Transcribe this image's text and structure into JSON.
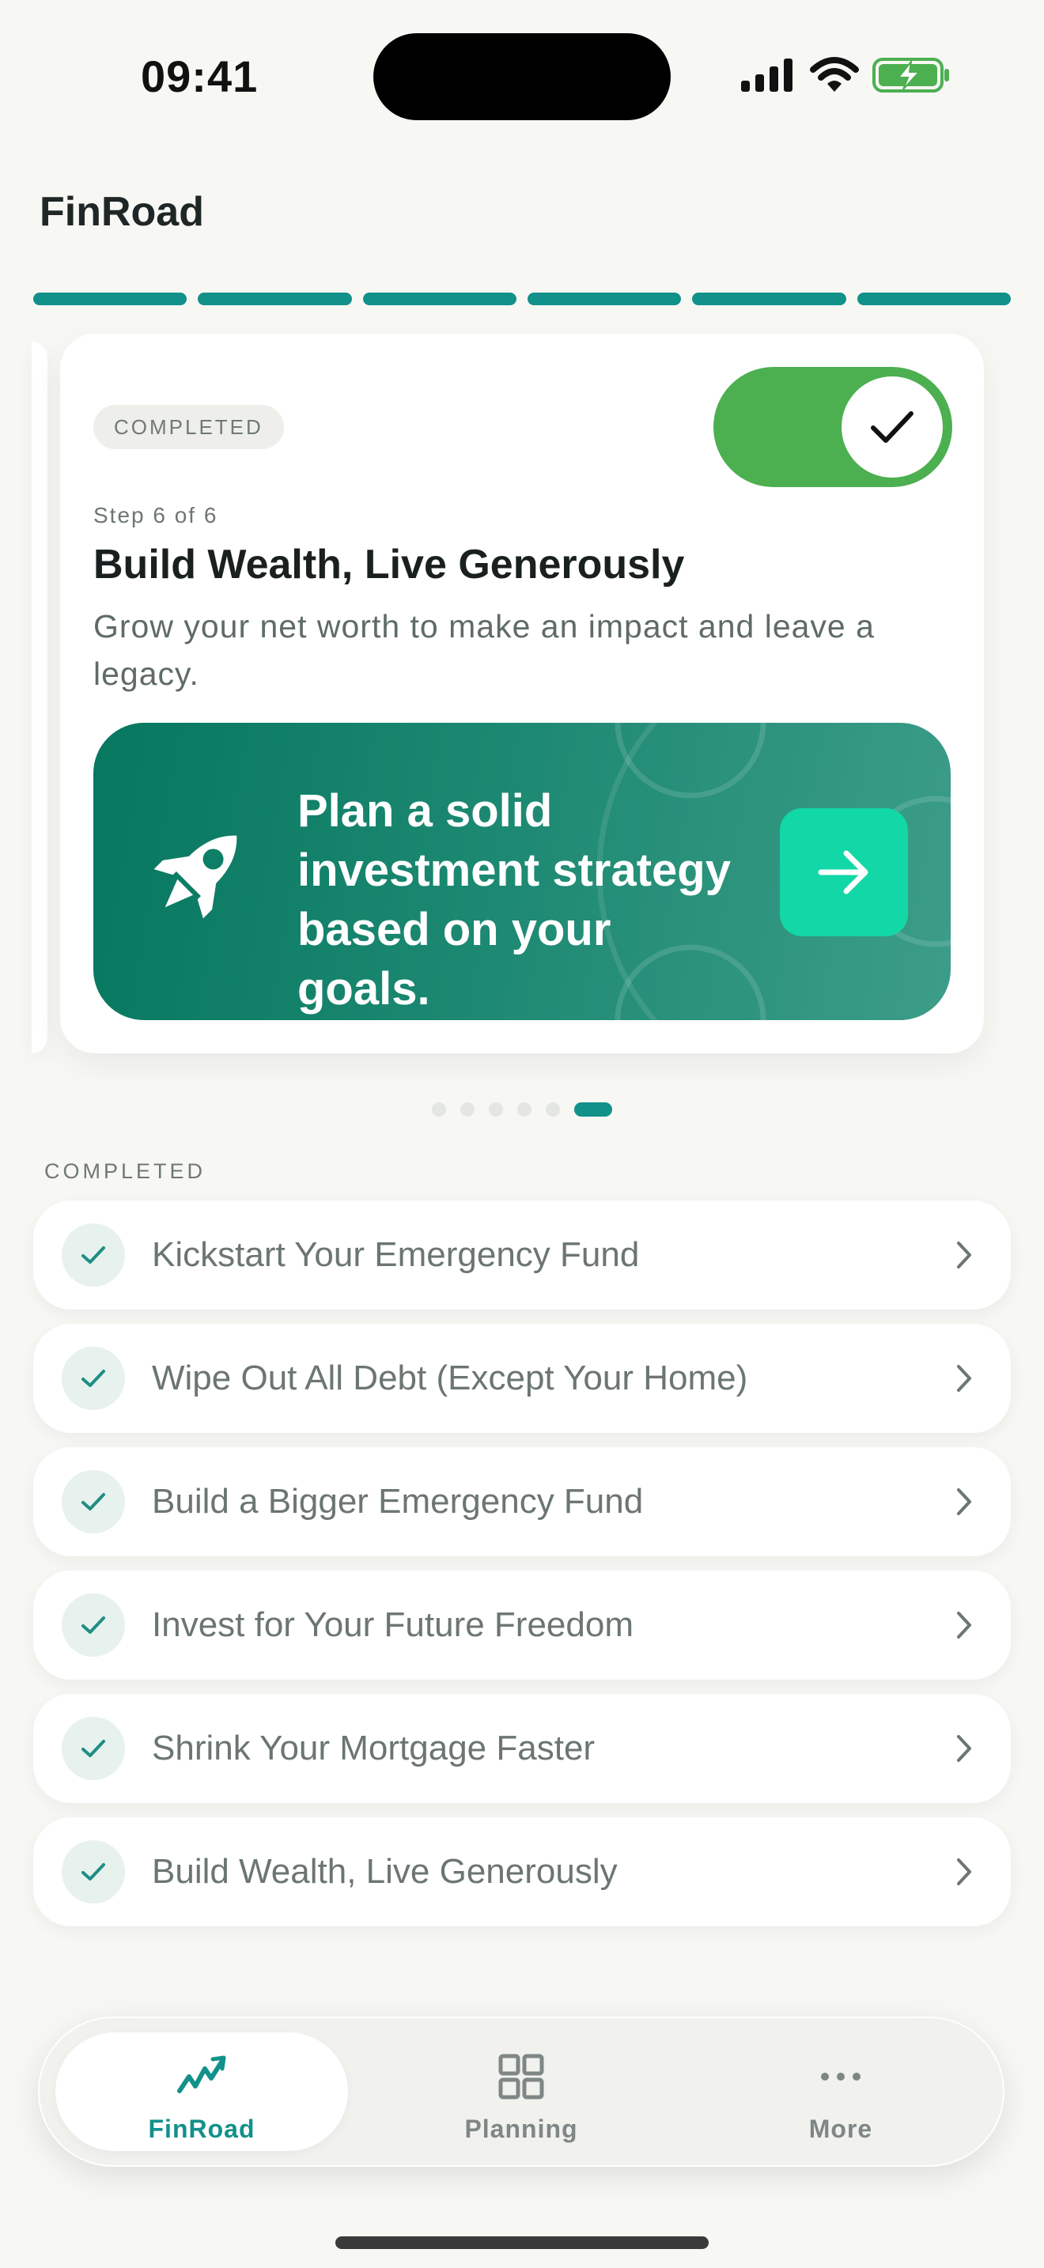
{
  "status_bar": {
    "time": "09:41"
  },
  "app": {
    "title": "FinRoad"
  },
  "progress": {
    "total_steps": 6,
    "completed_steps": 6
  },
  "card": {
    "badge": "COMPLETED",
    "toggle_on": true,
    "step": "Step 6 of 6",
    "title": "Build Wealth, Live Generously",
    "description": "Grow your net worth to make an impact and leave a legacy.",
    "cta_text": "Plan a solid investment strategy based on your goals.",
    "icon": "rocket-icon"
  },
  "pager": {
    "count": 6,
    "active_index": 5
  },
  "completed_section": {
    "label": "COMPLETED",
    "items": [
      {
        "label": "Kickstart Your Emergency Fund"
      },
      {
        "label": "Wipe Out All Debt (Except Your Home)"
      },
      {
        "label": "Build a Bigger Emergency Fund"
      },
      {
        "label": "Invest for Your Future Freedom"
      },
      {
        "label": "Shrink Your Mortgage Faster"
      },
      {
        "label": "Build Wealth, Live Generously"
      }
    ]
  },
  "tabbar": {
    "tabs": [
      {
        "label": "FinRoad",
        "icon": "chart-trend-icon",
        "active": true
      },
      {
        "label": "Planning",
        "icon": "grid-icon",
        "active": false
      },
      {
        "label": "More",
        "icon": "ellipsis-icon",
        "active": false
      }
    ]
  },
  "colors": {
    "accent": "#11918A",
    "toggle_green": "#4CAF50",
    "cta_start": "#07775F",
    "cta_end": "#3C9D88",
    "cta_button": "#12D7A6",
    "background": "#F7F7F4"
  }
}
